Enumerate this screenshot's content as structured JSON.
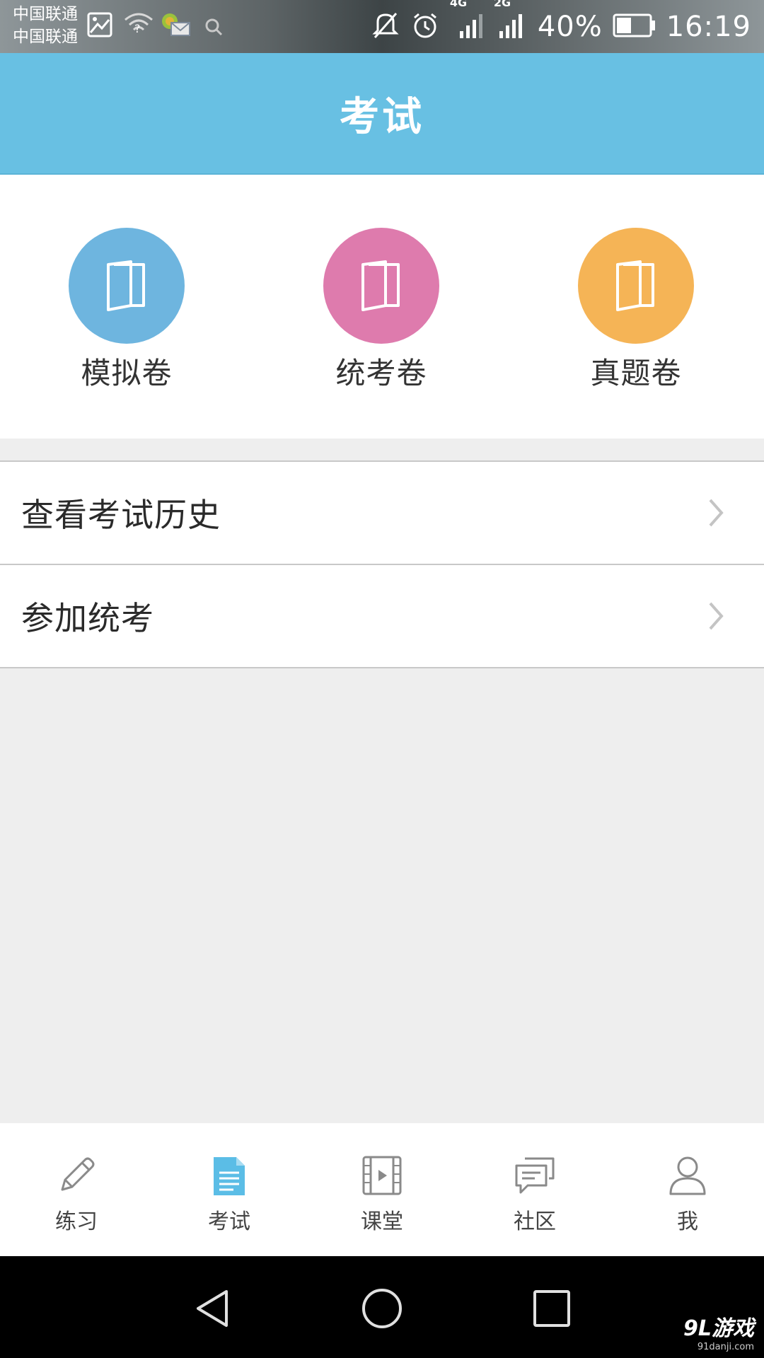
{
  "status_bar": {
    "carrier_1": "中国联通",
    "carrier_2": "中国联通",
    "net_4g": "4G",
    "net_2g": "2G",
    "battery_percent": "40%",
    "time": "16:19"
  },
  "header": {
    "title": "考试"
  },
  "categories": [
    {
      "label": "模拟卷",
      "color": "#6eb5df"
    },
    {
      "label": "统考卷",
      "color": "#de7bad"
    },
    {
      "label": "真题卷",
      "color": "#f5b456"
    }
  ],
  "list": [
    {
      "label": "查看考试历史"
    },
    {
      "label": "参加统考"
    }
  ],
  "tabs": [
    {
      "label": "练习",
      "icon": "pencil-icon",
      "active": false
    },
    {
      "label": "考试",
      "icon": "document-icon",
      "active": true
    },
    {
      "label": "课堂",
      "icon": "video-icon",
      "active": false
    },
    {
      "label": "社区",
      "icon": "chat-icon",
      "active": false
    },
    {
      "label": "我",
      "icon": "user-icon",
      "active": false
    }
  ],
  "colors": {
    "accent": "#68c0e3",
    "active_tab_icon": "#5bbde6",
    "inactive_tab_icon": "#8a8a8a"
  },
  "watermark": {
    "main": "9L游戏",
    "sub": "91danji.com"
  }
}
